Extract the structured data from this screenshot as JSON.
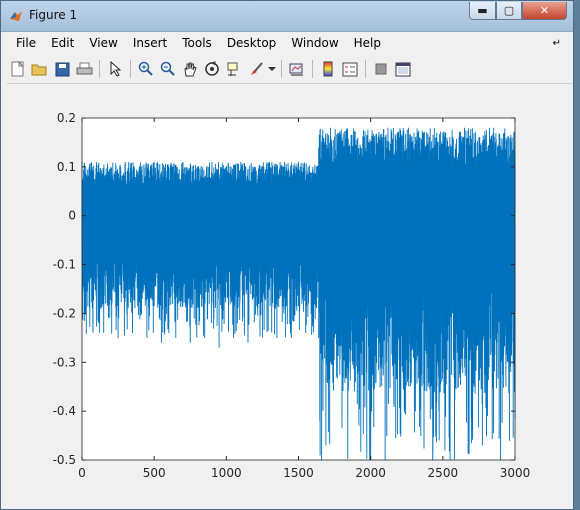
{
  "window": {
    "title": "Figure 1"
  },
  "menu": [
    "File",
    "Edit",
    "View",
    "Insert",
    "Tools",
    "Desktop",
    "Window",
    "Help"
  ],
  "menu_overflow_icon": "arrow-overflow-icon",
  "toolbar": [
    "new-figure-icon",
    "open-file-icon",
    "save-icon",
    "print-icon",
    "pointer-icon",
    "zoom-in-icon",
    "zoom-out-icon",
    "pan-hand-icon",
    "rotate-3d-icon",
    "data-cursor-icon",
    "brush-icon",
    "brush-dropdown-icon",
    "link-plot-icon",
    "colorbar-icon",
    "legend-icon",
    "hide-plot-tools-icon",
    "show-plot-tools-icon"
  ],
  "colors": {
    "line": "#0072bd",
    "axes": "#262626"
  },
  "chart_data": {
    "type": "line",
    "title": "",
    "xlabel": "",
    "ylabel": "",
    "xlim": [
      0,
      3000
    ],
    "ylim": [
      -0.5,
      0.2
    ],
    "xticks": [
      "0",
      "500",
      "1000",
      "1500",
      "2000",
      "2500",
      "3000"
    ],
    "yticks": [
      "0.2",
      "0.1",
      "0",
      "-0.1",
      "-0.2",
      "-0.3",
      "-0.4",
      "-0.5"
    ],
    "series": [
      {
        "description_segments": [
          {
            "x_range": [
              0,
              1640
            ],
            "upper": 0.11,
            "lower": -0.25
          },
          {
            "x_range": [
              1640,
              3000
            ],
            "upper": 0.18,
            "lower": -0.5
          }
        ],
        "x": [
          0,
          25,
          50,
          75,
          100,
          150,
          200,
          250,
          300,
          350,
          400,
          450,
          500,
          550,
          600,
          650,
          700,
          750,
          800,
          850,
          900,
          950,
          1000,
          1050,
          1100,
          1150,
          1200,
          1250,
          1300,
          1350,
          1400,
          1450,
          1500,
          1550,
          1600,
          1640,
          1660,
          1680,
          1700,
          1720,
          1750,
          1780,
          1800,
          1830,
          1850,
          1870,
          1900,
          1950,
          2000,
          2020,
          2050,
          2080,
          2100,
          2120,
          2150,
          2200,
          2250,
          2300,
          2350,
          2400,
          2430,
          2450,
          2480,
          2500,
          2550,
          2570,
          2600,
          2650,
          2700,
          2750,
          2800,
          2850,
          2900,
          2920,
          2950,
          2980,
          3000
        ],
        "y": [
          0.11,
          -0.2,
          0.1,
          -0.22,
          0.11,
          -0.24,
          0.1,
          -0.25,
          0.11,
          -0.24,
          0.1,
          -0.25,
          0.11,
          -0.26,
          0.1,
          -0.25,
          0.11,
          -0.26,
          0.1,
          -0.25,
          0.11,
          -0.27,
          0.1,
          -0.25,
          0.11,
          -0.26,
          0.1,
          -0.25,
          0.11,
          -0.25,
          0.1,
          -0.25,
          0.11,
          -0.24,
          0.1,
          -0.25,
          -0.5,
          0.15,
          -0.2,
          0.16,
          -0.25,
          0.17,
          -0.28,
          0.14,
          -0.3,
          0.16,
          -0.2,
          0.15,
          -0.5,
          0.14,
          -0.25,
          0.16,
          -0.5,
          0.18,
          -0.2,
          0.16,
          -0.28,
          0.17,
          -0.25,
          0.15,
          -0.5,
          0.16,
          -0.3,
          0.17,
          -0.5,
          0.16,
          -0.25,
          0.18,
          -0.3,
          0.16,
          -0.25,
          0.17,
          -0.5,
          0.15,
          -0.3,
          0.16,
          -0.25
        ]
      }
    ]
  }
}
